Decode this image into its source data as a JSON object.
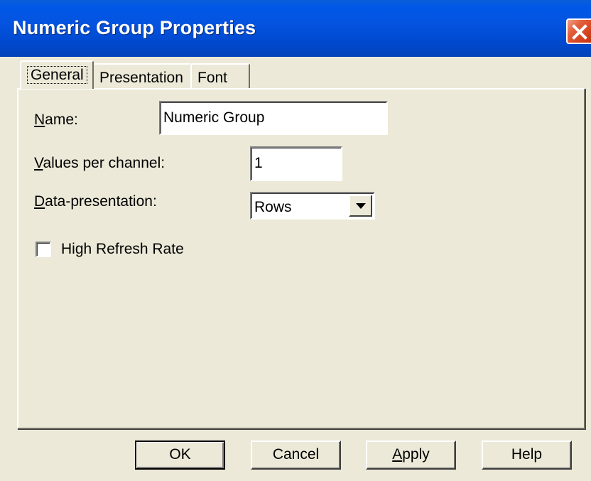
{
  "window": {
    "title": "Numeric Group Properties"
  },
  "tabs": [
    {
      "label": "General",
      "active": true
    },
    {
      "label": "Presentation",
      "active": false
    },
    {
      "label": "Font",
      "active": false
    }
  ],
  "form": {
    "name": {
      "mnemonic": "N",
      "label_rest": "ame:",
      "value": "Numeric Group"
    },
    "values_per_channel": {
      "mnemonic": "V",
      "label_rest": "alues per channel:",
      "value": "1"
    },
    "data_presentation": {
      "mnemonic": "D",
      "label_rest": "ata-presentation:",
      "selected": "Rows"
    },
    "high_refresh_rate": {
      "label": "High Refresh Rate",
      "checked": false
    }
  },
  "buttons": {
    "ok": "OK",
    "cancel": "Cancel",
    "apply_mnemonic": "A",
    "apply_rest": "pply",
    "help": "Help"
  },
  "colors": {
    "titlebar": "#0054E3",
    "dialog_bg": "#ECE9D8",
    "close": "#D6431F"
  }
}
